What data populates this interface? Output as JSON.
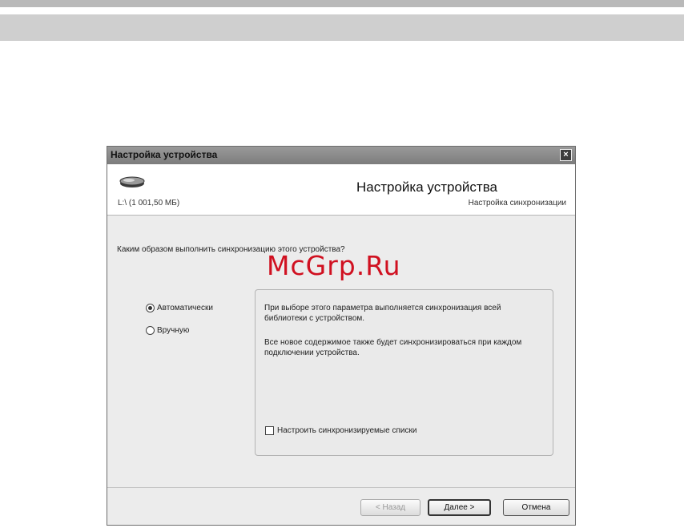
{
  "window": {
    "title": "Настройка устройства",
    "close_glyph": "×"
  },
  "header": {
    "icon": "drive-icon",
    "title": "Настройка устройства",
    "device_info": "L:\\ (1 001,50 МБ)",
    "step_label": "Настройка синхронизации"
  },
  "main": {
    "question": "Каким образом выполнить синхронизацию этого устройства?",
    "options": [
      {
        "label": "Автоматически",
        "selected": true
      },
      {
        "label": "Вручную",
        "selected": false
      }
    ],
    "description": [
      "При выборе этого параметра выполняется синхронизация всей библиотеки с устройством.",
      "Все новое содержимое также будет синхронизироваться при каждом подключении устройства."
    ],
    "checkbox": {
      "label": "Настроить синхронизируемые списки",
      "checked": false
    }
  },
  "buttons": {
    "back": "< Назад",
    "next": "Далее >",
    "cancel": "Отмена"
  },
  "watermark": "McGrp.Ru"
}
